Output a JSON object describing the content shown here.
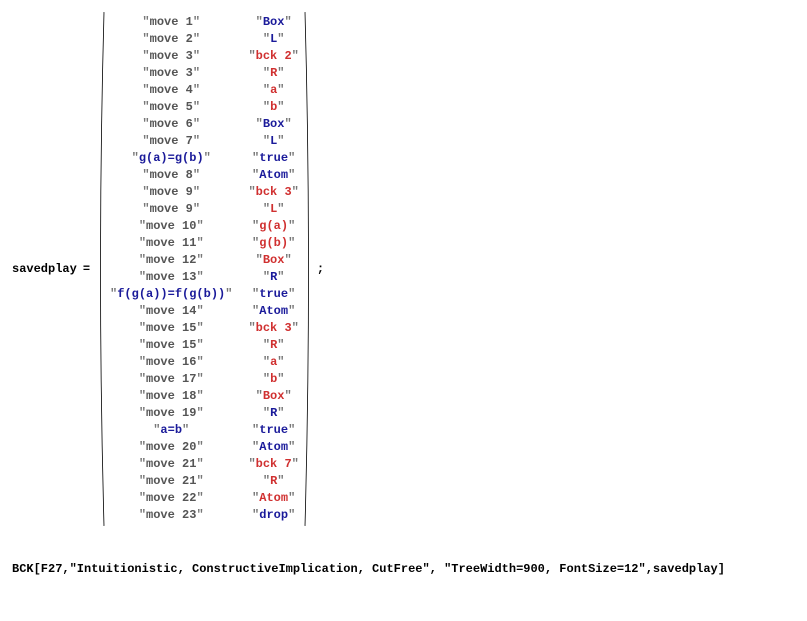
{
  "varname": "savedplay",
  "eq": "=",
  "semi": ";",
  "rows": [
    {
      "c1": "move 1",
      "c2": "Box",
      "c2_style": "keyword"
    },
    {
      "c1": "move 2",
      "c2": "L",
      "c2_style": "keyword"
    },
    {
      "c1": "move 3",
      "c2": "bck 2",
      "c2_style": "redword"
    },
    {
      "c1": "move 3",
      "c2": "R",
      "c2_style": "redword"
    },
    {
      "c1": "move 4",
      "c2": "a",
      "c2_style": "redword"
    },
    {
      "c1": "move 5",
      "c2": "b",
      "c2_style": "redword"
    },
    {
      "c1": "move 6",
      "c2": "Box",
      "c2_style": "keyword"
    },
    {
      "c1": "move 7",
      "c2": "L",
      "c2_style": "keyword"
    },
    {
      "c1": "g(a)=g(b)",
      "c1_style": "keyword",
      "c2": "true",
      "c2_style": "keyword"
    },
    {
      "c1": "move 8",
      "c2": "Atom",
      "c2_style": "keyword"
    },
    {
      "c1": "move 9",
      "c2": "bck 3",
      "c2_style": "redword"
    },
    {
      "c1": "move 9",
      "c2": "L",
      "c2_style": "redword"
    },
    {
      "c1": "move 10",
      "c2": "g(a)",
      "c2_style": "redword"
    },
    {
      "c1": "move 11",
      "c2": "g(b)",
      "c2_style": "redword"
    },
    {
      "c1": "move 12",
      "c2": "Box",
      "c2_style": "redword"
    },
    {
      "c1": "move 13",
      "c2": "R",
      "c2_style": "keyword"
    },
    {
      "c1": "f(g(a))=f(g(b))",
      "c1_style": "keyword",
      "c2": "true",
      "c2_style": "keyword"
    },
    {
      "c1": "move 14",
      "c2": "Atom",
      "c2_style": "keyword"
    },
    {
      "c1": "move 15",
      "c2": "bck 3",
      "c2_style": "redword"
    },
    {
      "c1": "move 15",
      "c2": "R",
      "c2_style": "redword"
    },
    {
      "c1": "move 16",
      "c2": "a",
      "c2_style": "redword"
    },
    {
      "c1": "move 17",
      "c2": "b",
      "c2_style": "redword"
    },
    {
      "c1": "move 18",
      "c2": "Box",
      "c2_style": "redword"
    },
    {
      "c1": "move 19",
      "c2": "R",
      "c2_style": "keyword"
    },
    {
      "c1": "a=b",
      "c1_style": "keyword",
      "c2": "true",
      "c2_style": "keyword"
    },
    {
      "c1": "move 20",
      "c2": "Atom",
      "c2_style": "keyword"
    },
    {
      "c1": "move 21",
      "c2": "bck 7",
      "c2_style": "redword"
    },
    {
      "c1": "move 21",
      "c2": "R",
      "c2_style": "redword"
    },
    {
      "c1": "move 22",
      "c2": "Atom",
      "c2_style": "redword"
    },
    {
      "c1": "move 23",
      "c2": "drop",
      "c2_style": "keyword"
    }
  ],
  "bottom": "BCK[F27,\"Intuitionistic, ConstructiveImplication, CutFree\", \"TreeWidth=900, FontSize=12\",savedplay]"
}
